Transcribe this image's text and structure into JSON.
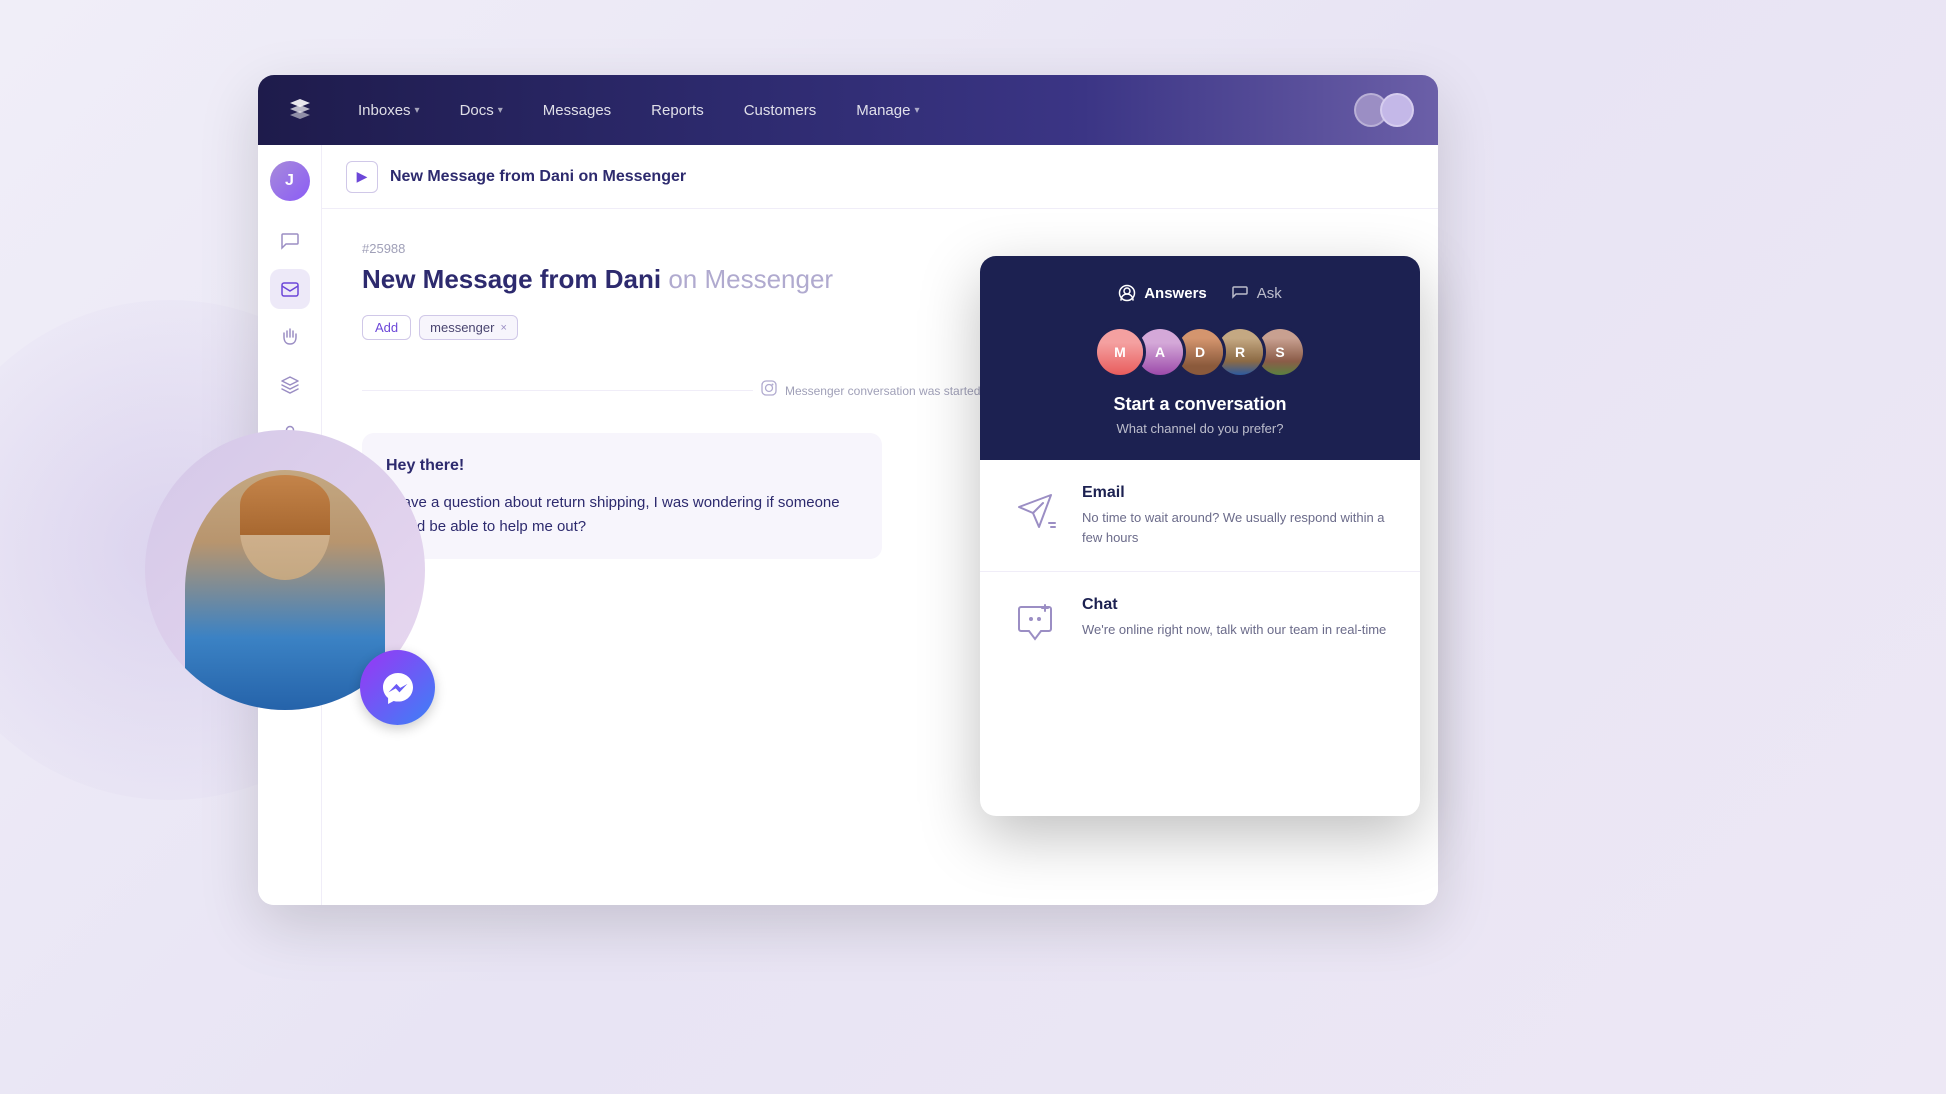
{
  "nav": {
    "logo_alt": "App Logo",
    "items": [
      {
        "label": "Inboxes",
        "has_dropdown": true
      },
      {
        "label": "Docs",
        "has_dropdown": true
      },
      {
        "label": "Messages",
        "has_dropdown": false
      },
      {
        "label": "Reports",
        "has_dropdown": false
      },
      {
        "label": "Customers",
        "has_dropdown": false
      },
      {
        "label": "Manage",
        "has_dropdown": true
      }
    ]
  },
  "sidebar": {
    "avatar_letter": "J",
    "icons": [
      {
        "name": "chat-icon",
        "symbol": "💬",
        "active": false
      },
      {
        "name": "inbox-icon",
        "symbol": "✉️",
        "active": true
      },
      {
        "name": "hand-icon",
        "symbol": "✋",
        "active": false
      },
      {
        "name": "layers-icon",
        "symbol": "🗂️",
        "active": false
      },
      {
        "name": "user-icon",
        "symbol": "👤",
        "active": false
      }
    ]
  },
  "conversation": {
    "toggle_label": "▶",
    "header_title": "New Message from Dani on Messenger",
    "id": "#25988",
    "subject_bold": "New Message from Dani",
    "subject_muted": "on Messenger",
    "tags": [
      "messenger"
    ],
    "add_tag_label": "Add",
    "divider_text": "Messenger conversation was started via",
    "messages": [
      {
        "greeting": "Hey there!",
        "body": "I have a question about return shipping, I was wondering if someone would be able to help me out?"
      }
    ]
  },
  "widget": {
    "answers_label": "Answers",
    "ask_label": "Ask",
    "start_title": "Start a conversation",
    "start_subtitle": "What channel do you prefer?",
    "channels": [
      {
        "name": "email",
        "title": "Email",
        "description": "No time to wait around? We usually respond within a few hours"
      },
      {
        "name": "chat",
        "title": "Chat",
        "description": "We're online right now, talk with our team in real-time"
      }
    ],
    "avatar_count": 5
  },
  "colors": {
    "brand_dark": "#1e1b4b",
    "brand_purple": "#6c47d8",
    "accent_light": "#ede9f8",
    "widget_bg": "#1c2151"
  }
}
